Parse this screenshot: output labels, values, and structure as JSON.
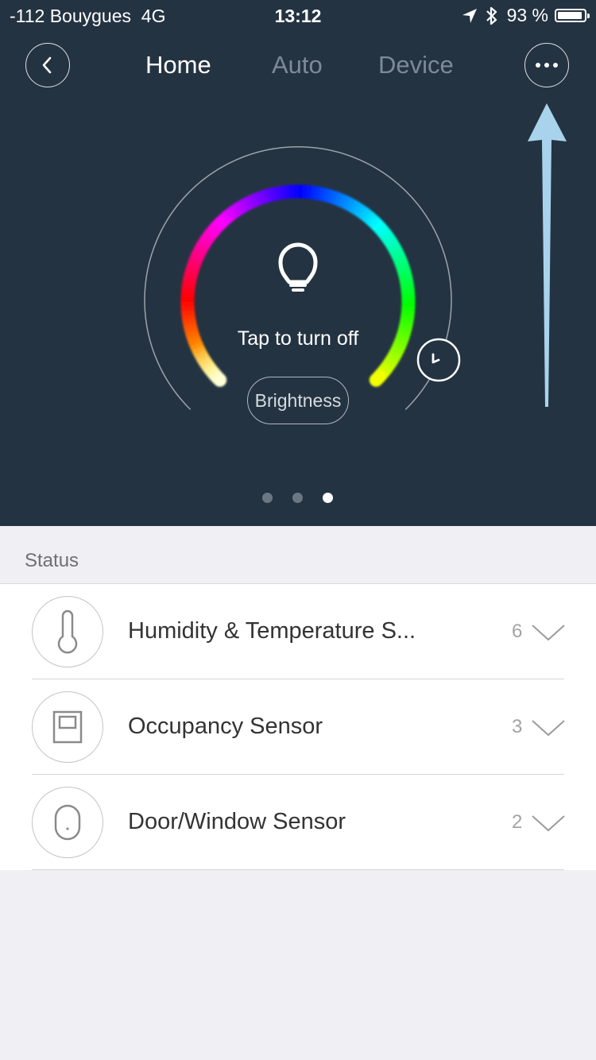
{
  "status_bar": {
    "carrier": "-112 Bouygues  4G",
    "time": "13:12",
    "battery": "93 %"
  },
  "tabs": [
    {
      "label": "Home",
      "active": true
    },
    {
      "label": "Auto",
      "active": false
    },
    {
      "label": "Device",
      "active": false
    }
  ],
  "light": {
    "action_label": "Tap to turn off",
    "brightness_label": "Brightness"
  },
  "pager": {
    "pages": 3,
    "current": 3
  },
  "status_section": {
    "title": "Status",
    "items": [
      {
        "label": "Humidity & Temperature S...",
        "count": "6",
        "icon": "thermometer-icon"
      },
      {
        "label": "Occupancy Sensor",
        "count": "3",
        "icon": "occupancy-sensor-icon"
      },
      {
        "label": "Door/Window Sensor",
        "count": "2",
        "icon": "door-window-sensor-icon"
      }
    ]
  },
  "colors": {
    "header_bg": "#243342",
    "page_bg": "#efeff4",
    "annotation_arrow": "#a9d3ec"
  }
}
